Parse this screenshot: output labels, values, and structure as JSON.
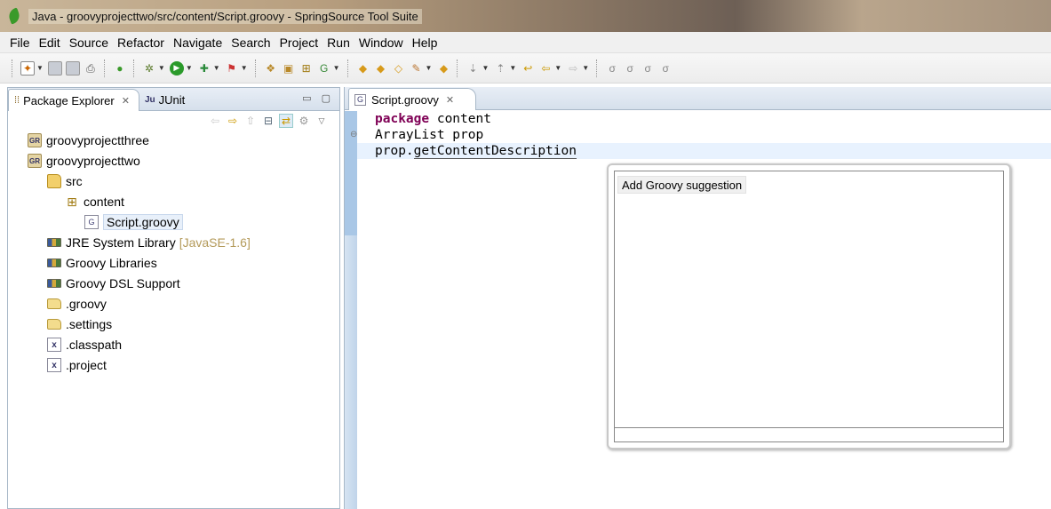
{
  "window": {
    "title": "Java - groovyprojecttwo/src/content/Script.groovy - SpringSource Tool Suite"
  },
  "menu": [
    "File",
    "Edit",
    "Source",
    "Refactor",
    "Navigate",
    "Search",
    "Project",
    "Run",
    "Window",
    "Help"
  ],
  "left_panel": {
    "tabs": [
      {
        "label": "Package Explorer",
        "icon": "package-explorer-icon"
      },
      {
        "label": "JUnit",
        "icon": "junit-icon"
      }
    ],
    "tree": [
      {
        "label": "groovyprojectthree",
        "icon": "groovy-project-icon"
      },
      {
        "label": "groovyprojecttwo",
        "icon": "groovy-project-icon"
      },
      {
        "label": "src",
        "icon": "source-folder-icon"
      },
      {
        "label": "content",
        "icon": "package-icon"
      },
      {
        "label": "Script.groovy",
        "icon": "groovy-file-icon"
      },
      {
        "label": "JRE System Library",
        "decoration": "[JavaSE-1.6]",
        "icon": "library-icon"
      },
      {
        "label": "Groovy Libraries",
        "icon": "library-icon"
      },
      {
        "label": "Groovy DSL Support",
        "icon": "library-icon"
      },
      {
        "label": ".groovy",
        "icon": "folder-icon"
      },
      {
        "label": ".settings",
        "icon": "folder-icon"
      },
      {
        "label": ".classpath",
        "icon": "xml-file-icon"
      },
      {
        "label": ".project",
        "icon": "xml-file-icon"
      }
    ]
  },
  "editor": {
    "tab_label": "Script.groovy",
    "code": {
      "line1_keyword": "package",
      "line1_rest": " content",
      "line2": "ArrayList prop",
      "line3_prefix": "prop.",
      "line3_member": "getContentDescription"
    }
  },
  "quick_fix": {
    "items": [
      "Add Groovy suggestion"
    ]
  },
  "colors": {
    "keyword": "#7f0055",
    "current_line": "#e8f2fe",
    "panel_border": "#a8b8c8"
  }
}
